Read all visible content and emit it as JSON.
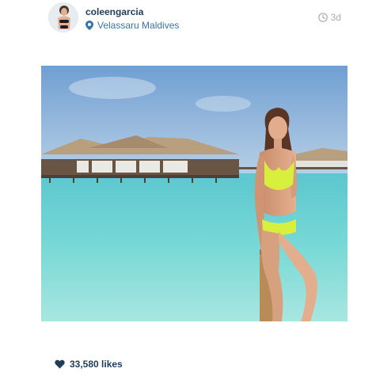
{
  "post": {
    "username": "coleengarcia",
    "location": "Velassaru Maldives",
    "time_ago": "3d",
    "likes_text": "33,580 likes"
  },
  "icons": {
    "location": "location-pin-icon",
    "time": "clock-icon",
    "likes": "heart-icon"
  },
  "colors": {
    "username": "#1f3c5a",
    "location": "#3a73a8",
    "muted": "#a6adb3",
    "sea": "#64d2d0",
    "sky": "#7fa9d6"
  }
}
